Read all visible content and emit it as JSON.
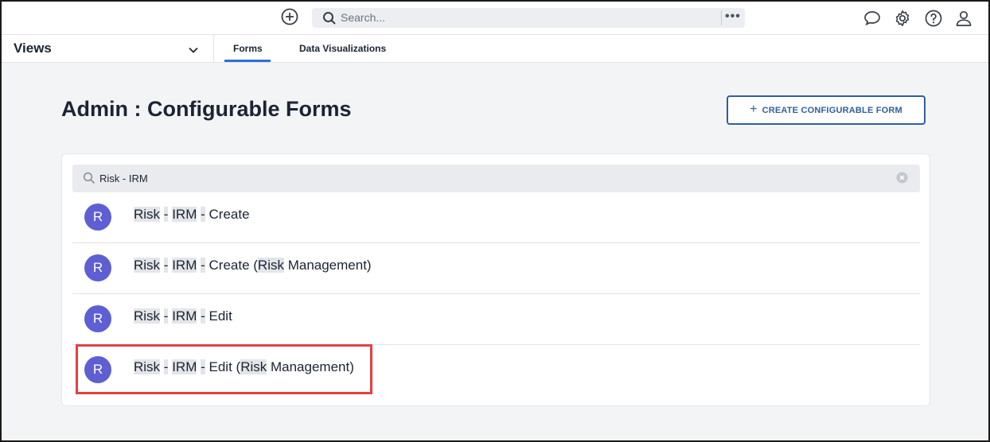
{
  "topbar": {
    "search_placeholder": "Search...",
    "more_label": "•••"
  },
  "subnav": {
    "views_label": "Views",
    "tabs": [
      {
        "label": "Forms",
        "active": true
      },
      {
        "label": "Data Visualizations",
        "active": false
      }
    ]
  },
  "header": {
    "title": "Admin : Configurable Forms",
    "create_button": {
      "icon": "+",
      "label": "CREATE CONFIGURABLE FORM"
    }
  },
  "filter": {
    "value": "Risk - IRM"
  },
  "results": [
    {
      "avatar": "R",
      "label": "Risk - IRM - Create",
      "parts": [
        [
          "Risk",
          true
        ],
        [
          " ",
          false
        ],
        [
          "-",
          true
        ],
        [
          " ",
          false
        ],
        [
          "IRM",
          true
        ],
        [
          " ",
          false
        ],
        [
          "-",
          true
        ],
        [
          " Create",
          false
        ]
      ]
    },
    {
      "avatar": "R",
      "label": "Risk - IRM - Create (Risk Management)",
      "parts": [
        [
          "Risk",
          true
        ],
        [
          " ",
          false
        ],
        [
          "-",
          true
        ],
        [
          " ",
          false
        ],
        [
          "IRM",
          true
        ],
        [
          " ",
          false
        ],
        [
          "-",
          true
        ],
        [
          " Create (",
          false
        ],
        [
          "Risk",
          true
        ],
        [
          " Management)",
          false
        ]
      ]
    },
    {
      "avatar": "R",
      "label": "Risk - IRM - Edit",
      "parts": [
        [
          "Risk",
          true
        ],
        [
          " ",
          false
        ],
        [
          "-",
          true
        ],
        [
          " ",
          false
        ],
        [
          "IRM",
          true
        ],
        [
          " ",
          false
        ],
        [
          "-",
          true
        ],
        [
          " Edit",
          false
        ]
      ]
    },
    {
      "avatar": "R",
      "label": "Risk - IRM - Edit (Risk Management)",
      "parts": [
        [
          "Risk",
          true
        ],
        [
          " ",
          false
        ],
        [
          "-",
          true
        ],
        [
          " ",
          false
        ],
        [
          "IRM",
          true
        ],
        [
          " ",
          false
        ],
        [
          "-",
          true
        ],
        [
          " Edit (",
          false
        ],
        [
          "Risk",
          true
        ],
        [
          " Management)",
          false
        ]
      ]
    }
  ],
  "colors": {
    "accent": "#2f6fd6",
    "avatar": "#5d5fd3",
    "button_border": "#2f5f9e",
    "highlight_box": "#e3403f"
  },
  "icons": [
    "add-circle-icon",
    "search-icon",
    "chat-icon",
    "gear-icon",
    "help-icon",
    "user-icon",
    "chevron-down-icon",
    "clear-icon"
  ]
}
